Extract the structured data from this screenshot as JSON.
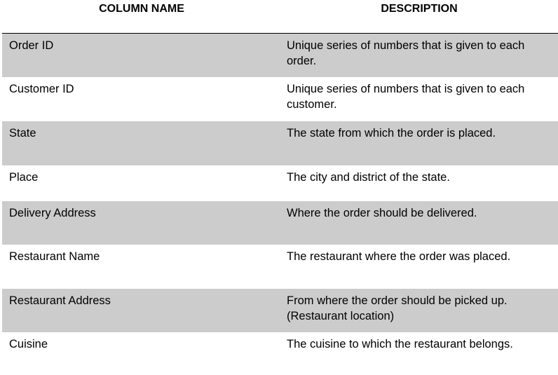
{
  "table": {
    "headers": {
      "column_name": "COLUMN NAME",
      "description": "DESCRIPTION"
    },
    "rows": [
      {
        "name": "Order ID",
        "description": "Unique series of numbers that is given to each order."
      },
      {
        "name": "Customer ID",
        "description": "Unique series of numbers that is given to each customer."
      },
      {
        "name": "State",
        "description": "The state from which the order is placed."
      },
      {
        "name": "Place",
        "description": "The city and district of the state."
      },
      {
        "name": "Delivery Address",
        "description": "Where the order should be delivered."
      },
      {
        "name": "Restaurant Name",
        "description": "The restaurant where the order was placed."
      },
      {
        "name": "Restaurant Address",
        "description": "From where the order should be picked up.(Restaurant location)"
      },
      {
        "name": "Cuisine",
        "description": "The cuisine to which the restaurant belongs."
      }
    ],
    "shade_color": "#cccccc",
    "rule_color": "#000000"
  }
}
